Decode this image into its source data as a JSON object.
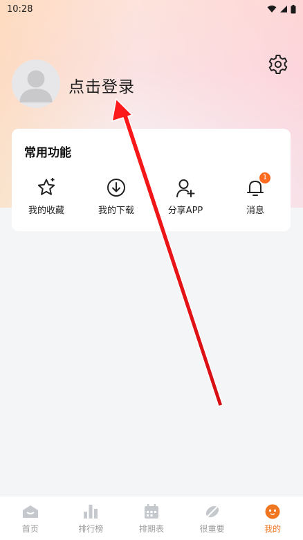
{
  "status": {
    "time": "10:28"
  },
  "header": {
    "login_text": "点击登录"
  },
  "features": {
    "title": "常用功能",
    "items": [
      {
        "label": "我的收藏",
        "icon": "star-icon"
      },
      {
        "label": "我的下载",
        "icon": "download-icon"
      },
      {
        "label": "分享APP",
        "icon": "add-user-icon"
      },
      {
        "label": "消息",
        "icon": "bell-icon",
        "badge": "1"
      }
    ]
  },
  "tabbar": {
    "items": [
      {
        "label": "首页",
        "icon": "home-icon"
      },
      {
        "label": "排行榜",
        "icon": "ranking-icon"
      },
      {
        "label": "排期表",
        "icon": "calendar-icon"
      },
      {
        "label": "很重要",
        "icon": "leaf-icon"
      },
      {
        "label": "我的",
        "icon": "profile-icon"
      }
    ],
    "active": "我的"
  },
  "colors": {
    "accent": "#f07621",
    "badge": "#ff6a1f",
    "annotation_arrow": "#e8141c"
  }
}
